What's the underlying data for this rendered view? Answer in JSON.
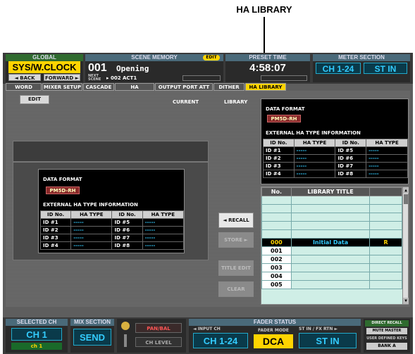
{
  "callout": {
    "label": "HA LIBRARY"
  },
  "global": {
    "header": "GLOBAL",
    "value": "SYS/W.CLOCK",
    "back_label": "◄ BACK",
    "forward_label": "FORWARD ►"
  },
  "scene": {
    "header": "SCENE MEMORY",
    "edit_badge": "EDIT",
    "number": "001",
    "name": "Opening",
    "next_label": "NEXT SCENE",
    "next_scene": "▸ 002 ACT1"
  },
  "preset": {
    "header": "PRESET TIME",
    "time": "4:58:07"
  },
  "meter": {
    "header": "METER SECTION",
    "left": "CH 1-24",
    "right": "ST IN"
  },
  "tabs": [
    "WORD CLOCK",
    "MIXER SETUP",
    "CASCADE",
    "HA",
    "OUTPUT PORT ATT",
    "DITHER",
    "HA LIBRARY"
  ],
  "left": {
    "edit_label": "EDIT",
    "current_label": "CURRENT",
    "data_format_label": "DATA FORMAT",
    "data_format_value": "PM5D-RH",
    "info_label": "EXTERNAL HA TYPE INFORMATION",
    "col_headers": [
      "ID No.",
      "HA TYPE",
      "ID No.",
      "HA TYPE"
    ],
    "rows": [
      [
        "ID #1",
        "-----",
        "ID #5",
        "-----"
      ],
      [
        "ID #2",
        "-----",
        "ID #6",
        "-----"
      ],
      [
        "ID #3",
        "-----",
        "ID #7",
        "-----"
      ],
      [
        "ID #4",
        "-----",
        "ID #8",
        "-----"
      ]
    ]
  },
  "library": {
    "label": "LIBRARY",
    "data_format_label": "DATA FORMAT",
    "data_format_value": "PM5D-RH",
    "info_label": "EXTERNAL HA TYPE INFORMATION",
    "col_headers": [
      "ID No.",
      "HA TYPE",
      "ID No.",
      "HA TYPE"
    ],
    "rows": [
      [
        "ID #1",
        "-----",
        "ID #5",
        "-----"
      ],
      [
        "ID #2",
        "-----",
        "ID #6",
        "-----"
      ],
      [
        "ID #3",
        "-----",
        "ID #7",
        "-----"
      ],
      [
        "ID #4",
        "-----",
        "ID #8",
        "-----"
      ]
    ],
    "list_headers": [
      "No.",
      "LIBRARY TITLE"
    ],
    "list_rows": [
      [
        "000",
        "Initial Data",
        "R"
      ],
      [
        "001",
        "",
        ""
      ],
      [
        "002",
        "",
        ""
      ],
      [
        "003",
        "",
        ""
      ],
      [
        "004",
        "",
        ""
      ],
      [
        "005",
        "",
        ""
      ]
    ],
    "recall_label": "◄ RECALL",
    "store_label": "STORE ►",
    "title_edit_label": "TITLE EDIT",
    "clear_label": "CLEAR"
  },
  "bottom": {
    "selected_ch_header": "SELECTED CH",
    "selected_ch_value": "CH 1",
    "selected_ch_sub": "ch 1",
    "mix_header": "MIX SECTION",
    "mix_value": "SEND",
    "pan_label": "PAN/BAL",
    "ch_level_label": "CH LEVEL",
    "fader_header": "FADER STATUS",
    "input_ch_label": "◄ INPUT CH",
    "input_ch_value": "CH 1-24",
    "fader_mode_label": "FADER MODE",
    "fader_mode_value": "DCA",
    "st_in_label": "ST IN / FX RTN ►",
    "st_in_value": "ST IN",
    "direct_recall": "DIRECT RECALL",
    "mute_master": "MUTE MASTER",
    "user_defined": "USER DEFINED KEYS",
    "bank": "BANK A"
  }
}
